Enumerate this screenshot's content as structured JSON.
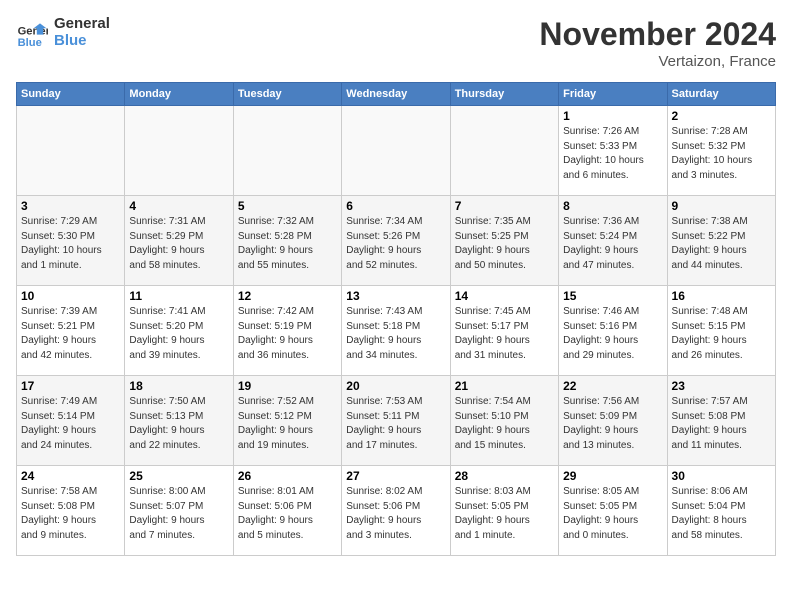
{
  "header": {
    "logo_line1": "General",
    "logo_line2": "Blue",
    "month": "November 2024",
    "location": "Vertaizon, France"
  },
  "weekdays": [
    "Sunday",
    "Monday",
    "Tuesday",
    "Wednesday",
    "Thursday",
    "Friday",
    "Saturday"
  ],
  "weeks": [
    [
      {
        "day": "",
        "info": ""
      },
      {
        "day": "",
        "info": ""
      },
      {
        "day": "",
        "info": ""
      },
      {
        "day": "",
        "info": ""
      },
      {
        "day": "",
        "info": ""
      },
      {
        "day": "1",
        "info": "Sunrise: 7:26 AM\nSunset: 5:33 PM\nDaylight: 10 hours\nand 6 minutes."
      },
      {
        "day": "2",
        "info": "Sunrise: 7:28 AM\nSunset: 5:32 PM\nDaylight: 10 hours\nand 3 minutes."
      }
    ],
    [
      {
        "day": "3",
        "info": "Sunrise: 7:29 AM\nSunset: 5:30 PM\nDaylight: 10 hours\nand 1 minute."
      },
      {
        "day": "4",
        "info": "Sunrise: 7:31 AM\nSunset: 5:29 PM\nDaylight: 9 hours\nand 58 minutes."
      },
      {
        "day": "5",
        "info": "Sunrise: 7:32 AM\nSunset: 5:28 PM\nDaylight: 9 hours\nand 55 minutes."
      },
      {
        "day": "6",
        "info": "Sunrise: 7:34 AM\nSunset: 5:26 PM\nDaylight: 9 hours\nand 52 minutes."
      },
      {
        "day": "7",
        "info": "Sunrise: 7:35 AM\nSunset: 5:25 PM\nDaylight: 9 hours\nand 50 minutes."
      },
      {
        "day": "8",
        "info": "Sunrise: 7:36 AM\nSunset: 5:24 PM\nDaylight: 9 hours\nand 47 minutes."
      },
      {
        "day": "9",
        "info": "Sunrise: 7:38 AM\nSunset: 5:22 PM\nDaylight: 9 hours\nand 44 minutes."
      }
    ],
    [
      {
        "day": "10",
        "info": "Sunrise: 7:39 AM\nSunset: 5:21 PM\nDaylight: 9 hours\nand 42 minutes."
      },
      {
        "day": "11",
        "info": "Sunrise: 7:41 AM\nSunset: 5:20 PM\nDaylight: 9 hours\nand 39 minutes."
      },
      {
        "day": "12",
        "info": "Sunrise: 7:42 AM\nSunset: 5:19 PM\nDaylight: 9 hours\nand 36 minutes."
      },
      {
        "day": "13",
        "info": "Sunrise: 7:43 AM\nSunset: 5:18 PM\nDaylight: 9 hours\nand 34 minutes."
      },
      {
        "day": "14",
        "info": "Sunrise: 7:45 AM\nSunset: 5:17 PM\nDaylight: 9 hours\nand 31 minutes."
      },
      {
        "day": "15",
        "info": "Sunrise: 7:46 AM\nSunset: 5:16 PM\nDaylight: 9 hours\nand 29 minutes."
      },
      {
        "day": "16",
        "info": "Sunrise: 7:48 AM\nSunset: 5:15 PM\nDaylight: 9 hours\nand 26 minutes."
      }
    ],
    [
      {
        "day": "17",
        "info": "Sunrise: 7:49 AM\nSunset: 5:14 PM\nDaylight: 9 hours\nand 24 minutes."
      },
      {
        "day": "18",
        "info": "Sunrise: 7:50 AM\nSunset: 5:13 PM\nDaylight: 9 hours\nand 22 minutes."
      },
      {
        "day": "19",
        "info": "Sunrise: 7:52 AM\nSunset: 5:12 PM\nDaylight: 9 hours\nand 19 minutes."
      },
      {
        "day": "20",
        "info": "Sunrise: 7:53 AM\nSunset: 5:11 PM\nDaylight: 9 hours\nand 17 minutes."
      },
      {
        "day": "21",
        "info": "Sunrise: 7:54 AM\nSunset: 5:10 PM\nDaylight: 9 hours\nand 15 minutes."
      },
      {
        "day": "22",
        "info": "Sunrise: 7:56 AM\nSunset: 5:09 PM\nDaylight: 9 hours\nand 13 minutes."
      },
      {
        "day": "23",
        "info": "Sunrise: 7:57 AM\nSunset: 5:08 PM\nDaylight: 9 hours\nand 11 minutes."
      }
    ],
    [
      {
        "day": "24",
        "info": "Sunrise: 7:58 AM\nSunset: 5:08 PM\nDaylight: 9 hours\nand 9 minutes."
      },
      {
        "day": "25",
        "info": "Sunrise: 8:00 AM\nSunset: 5:07 PM\nDaylight: 9 hours\nand 7 minutes."
      },
      {
        "day": "26",
        "info": "Sunrise: 8:01 AM\nSunset: 5:06 PM\nDaylight: 9 hours\nand 5 minutes."
      },
      {
        "day": "27",
        "info": "Sunrise: 8:02 AM\nSunset: 5:06 PM\nDaylight: 9 hours\nand 3 minutes."
      },
      {
        "day": "28",
        "info": "Sunrise: 8:03 AM\nSunset: 5:05 PM\nDaylight: 9 hours\nand 1 minute."
      },
      {
        "day": "29",
        "info": "Sunrise: 8:05 AM\nSunset: 5:05 PM\nDaylight: 9 hours\nand 0 minutes."
      },
      {
        "day": "30",
        "info": "Sunrise: 8:06 AM\nSunset: 5:04 PM\nDaylight: 8 hours\nand 58 minutes."
      }
    ]
  ]
}
